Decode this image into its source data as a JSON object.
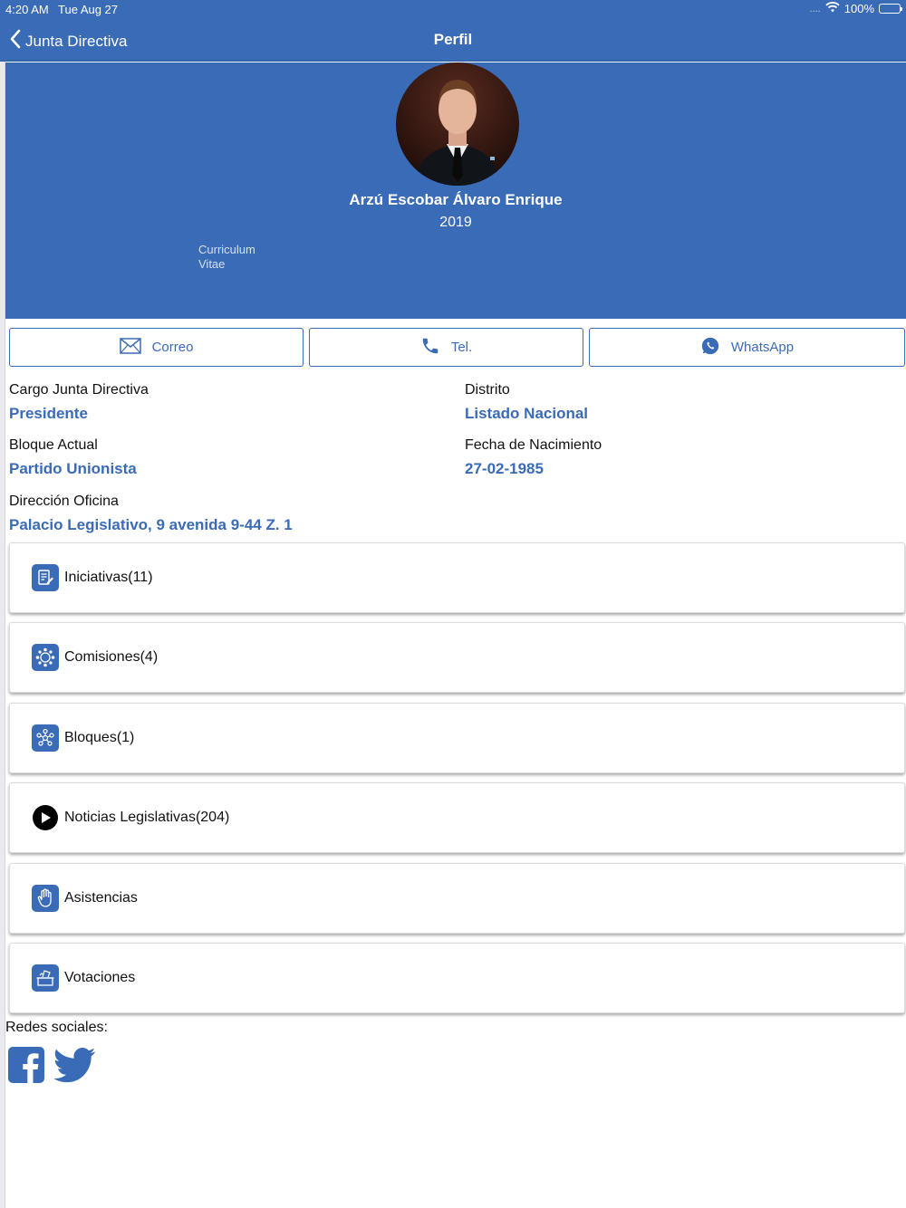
{
  "status_bar": {
    "time": "4:20 AM",
    "date": "Tue Aug 27",
    "signal": "....",
    "battery": "100%"
  },
  "nav": {
    "back_label": "Junta Directiva",
    "title": "Perfil"
  },
  "profile": {
    "name": "Arzú Escobar Álvaro Enrique",
    "year": "2019",
    "cv_link": "Curriculum Vitae"
  },
  "contact": {
    "email_label": "Correo",
    "phone_label": "Tel.",
    "whatsapp_label": "WhatsApp"
  },
  "info": {
    "cargo_label": "Cargo Junta Directiva",
    "cargo_value": "Presidente",
    "distrito_label": "Distrito",
    "distrito_value": "Listado Nacional",
    "bloque_label": "Bloque Actual",
    "bloque_value": "Partido Unionista",
    "nacimiento_label": "Fecha de Nacimiento",
    "nacimiento_value": "27-02-1985",
    "direccion_label": "Dirección Oficina",
    "direccion_value": "Palacio Legislativo, 9 avenida 9-44 Z. 1"
  },
  "menu": {
    "items": [
      {
        "label": "Iniciativas(11)",
        "icon": "document-edit-icon"
      },
      {
        "label": "Comisiones(4)",
        "icon": "committee-icon"
      },
      {
        "label": "Bloques(1)",
        "icon": "network-icon"
      },
      {
        "label": "Noticias Legislativas(204)",
        "icon": "play-icon"
      },
      {
        "label": "Asistencias",
        "icon": "hand-icon"
      },
      {
        "label": "Votaciones",
        "icon": "ballot-box-icon"
      }
    ]
  },
  "social": {
    "label": "Redes sociales:"
  },
  "colors": {
    "brand": "#3a6bb6",
    "whatsapp": "#3a6bb6"
  }
}
